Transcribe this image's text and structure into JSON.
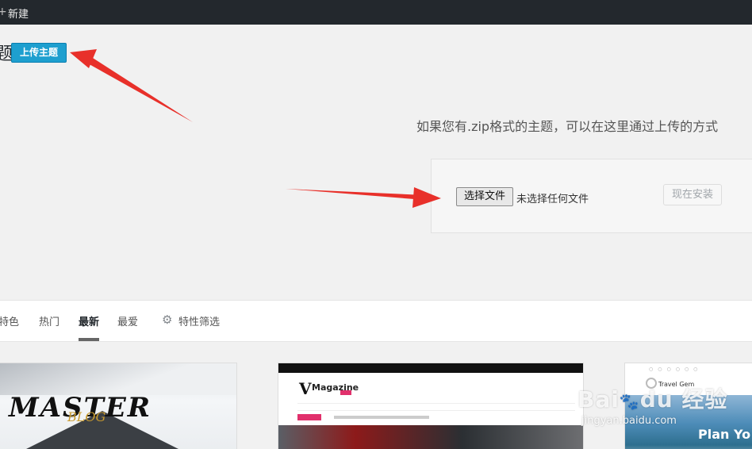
{
  "admin_bar": {
    "new_label": "新建"
  },
  "header": {
    "title_fragment": "题",
    "upload_theme_label": "上传主题"
  },
  "upload": {
    "description": "如果您有.zip格式的主题，可以在这里通过上传的方式",
    "choose_file_label": "选择文件",
    "file_status": "未选择任何文件",
    "install_now_label": "现在安装"
  },
  "filter": {
    "tabs": [
      "特色",
      "热门",
      "最新",
      "最爱"
    ],
    "active_tab": "最新",
    "feature_filter_label": "特性筛选"
  },
  "themes": {
    "card1": {
      "title": "MASTER",
      "subtitle": "BLOG"
    },
    "card2": {
      "logo_text": "Magazine"
    },
    "card3": {
      "brand": "Travel Gem",
      "headline": "Plan Yo"
    }
  },
  "watermark": {
    "logo": "Bai du 经验",
    "url": "jingyan.baidu.com"
  },
  "colors": {
    "accent": "#1e9fcf",
    "annotation_arrow": "#e8302a",
    "admin_bar": "#23282d"
  }
}
